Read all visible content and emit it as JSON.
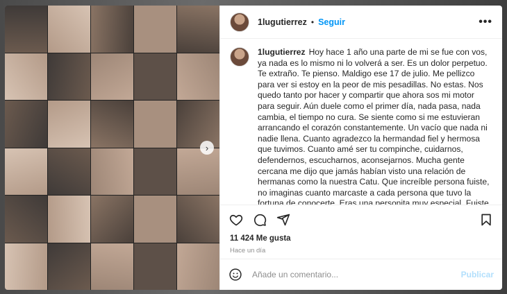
{
  "post": {
    "username": "1lugutierrez",
    "separator": "•",
    "follow_label": "Seguir",
    "more_label": "•••",
    "caption": "Hoy hace 1 año una parte de mi se fue con vos, ya nada es lo mismo ni lo volverá a ser. Es un dolor perpetuo. Te extraño. Te pienso. Maldigo ese 17 de julio. Me pellizco para ver si estoy en la peor de mis pesadillas. No estas. Nos quedo tanto por hacer y compartir que ahora sos mi motor para seguir. Aún duele como el primer día, nada pasa, nada cambia, el tiempo no cura. Se siente como si me estuvieran arrancando el corazón constantemente. Un vacío que nada ni nadie llena. Cuanto agradezco la hermandad fiel y hermosa que tuvimos. Cuanto amé ser tu compinche, cuidarnos, defendernos, escucharnos, aconsejarnos. Mucha gente cercana me dijo que jamás habían visto una relación de hermanas como la nuestra Catu. Que increíble persona fuiste, no imaginas cuanto marcaste a cada persona que tuvo la fortuna de conocerte. Eras una personita muy especial. Fuiste y sos luz para siempre. Tan buena, tan",
    "likes": "11 424 Me gusta",
    "time": "Hace un día",
    "comment_placeholder": "Añade un comentario...",
    "publish_label": "Publicar",
    "next_icon": "chevron-right-icon"
  }
}
